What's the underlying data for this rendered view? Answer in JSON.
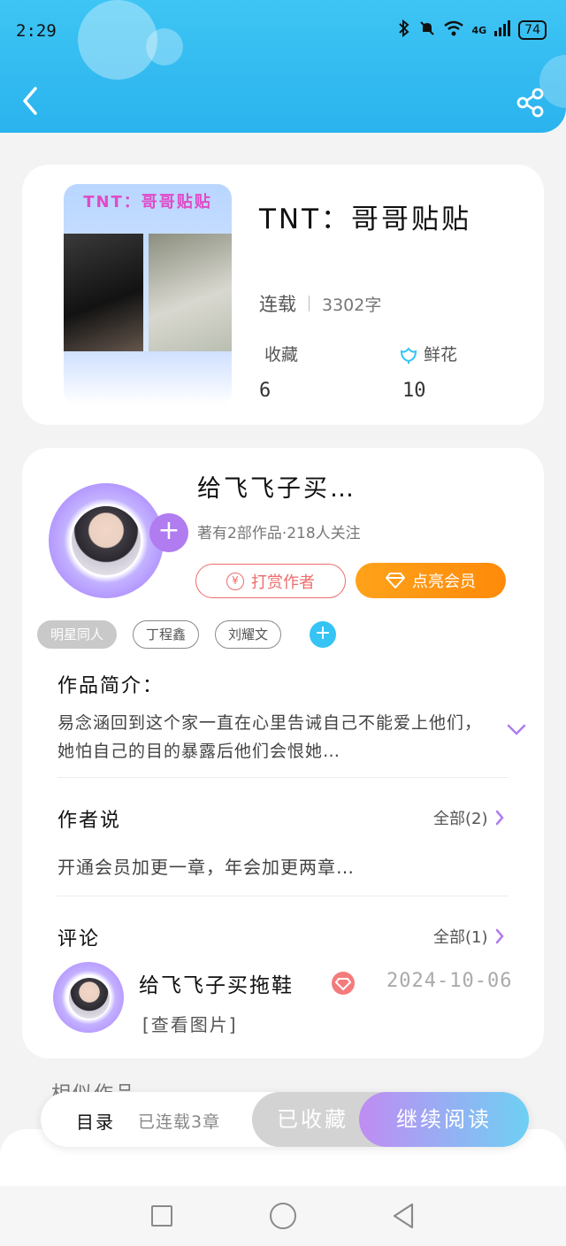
{
  "status_bar": {
    "time": "2:29",
    "network": "4G",
    "battery": "74"
  },
  "header": {
    "back_icon": "chevron-left-icon",
    "share_icon": "share-icon"
  },
  "book": {
    "cover_title": "TNT：哥哥贴贴",
    "title": "TNT：哥哥贴贴",
    "status": "连载",
    "word_count": "3302字",
    "favorites_label": "收藏",
    "favorites_value": "6",
    "flowers_label": "鲜花",
    "flowers_value": "10"
  },
  "author": {
    "name": "给飞飞子买…",
    "meta": "著有2部作品·218人关注",
    "reward_label": "打赏作者",
    "vip_label": "点亮会员"
  },
  "tags": [
    "明星同人",
    "丁程鑫",
    "刘耀文"
  ],
  "intro": {
    "title": "作品简介：",
    "text": "易念涵回到这个家一直在心里告诫自己不能爱上他们，她怕自己的目的暴露后他们会恨她…"
  },
  "author_says": {
    "title": "作者说",
    "all_label": "全部(2)",
    "text": "开通会员加更一章，年会加更两章…"
  },
  "comments": {
    "title": "评论",
    "all_label": "全部(1)",
    "items": [
      {
        "name": "给飞飞子买拖鞋",
        "date": "2024-10-06",
        "text": "[查看图片]"
      }
    ]
  },
  "similar_title": "相似作品",
  "action_bar": {
    "toc_label": "目录",
    "toc_count": "已连载3章",
    "collected_label": "已收藏",
    "continue_label": "继续阅读"
  },
  "colors": {
    "accent": "#2ab3ee",
    "vip_orange": "#ff8a0a",
    "reward_red": "#ee6c6c",
    "purple": "#b07cf0"
  }
}
